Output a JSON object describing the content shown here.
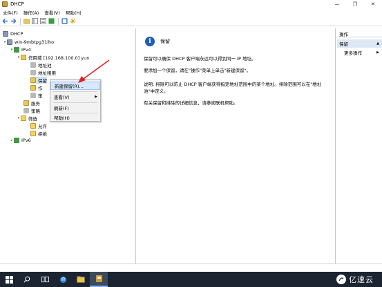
{
  "window": {
    "title": "DHCP",
    "min": "—",
    "restore": "❐",
    "close": "✕"
  },
  "menubar": [
    "文件(F)",
    "操作(A)",
    "查看(V)",
    "帮助(H)"
  ],
  "tree": {
    "root": "DHCP",
    "server": "win-9mbtpg31iho",
    "ipv4": "IPv4",
    "scope": "作用域 [192.168.100.0] yun",
    "pool": "地址池",
    "leases": "地址租用",
    "reservations": "保留",
    "scope_options": "作",
    "policies": "策",
    "server_options": "服务",
    "policies2": "策略",
    "filters": "筛选",
    "allow": "允许",
    "deny": "拒绝",
    "ipv6": "IPv6"
  },
  "context_menu": {
    "new_reservation": "新建保留(R)...",
    "view": "查看(V)",
    "refresh": "刷新(F)",
    "help": "帮助(H)"
  },
  "content": {
    "title": "保留",
    "p1": "保留可以确保 DHCP 客户端永远可以得到同一 IP 地址。",
    "p2": "要添加一个保留，请在\"操作\"菜单上单击\"新建保留\"。",
    "p3a": "说明: 排除可以防止 DHCP 客户端获得指定地址范围中的某个地址。排除范围可以在\"地址",
    "p3b": "池\"中定义。",
    "p4": "有关保留和排除的详细信息，请参阅联机帮助。"
  },
  "actions": {
    "header": "操作",
    "section": "保留",
    "more": "更多操作"
  },
  "watermark": {
    "text": "亿速云"
  },
  "colors": {
    "accent": "#1e5eb3",
    "selection": "#d9e8fb",
    "taskbar": "#1b2430"
  }
}
